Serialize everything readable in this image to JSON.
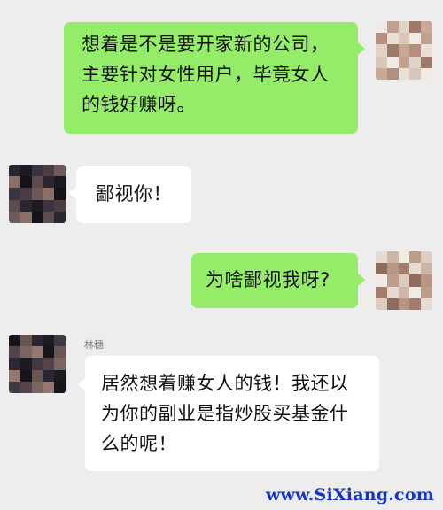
{
  "messages": [
    {
      "side": "me",
      "text": "想着是不是要开家新的公司，主要针对女性用户，毕竟女人的钱好赚呀。"
    },
    {
      "side": "other",
      "text": "鄙视你！"
    },
    {
      "side": "me",
      "text": "为啥鄙视我呀?"
    },
    {
      "side": "other",
      "sender": "林穗",
      "text": "居然想着赚女人的钱！我还以为你的副业是指炒股买基金什么的呢！"
    }
  ],
  "watermark": "www.SiXiang.com",
  "colors": {
    "background": "#ededed",
    "outgoing_bubble": "#95ec69",
    "incoming_bubble": "#ffffff",
    "watermark": "#1733c4"
  }
}
